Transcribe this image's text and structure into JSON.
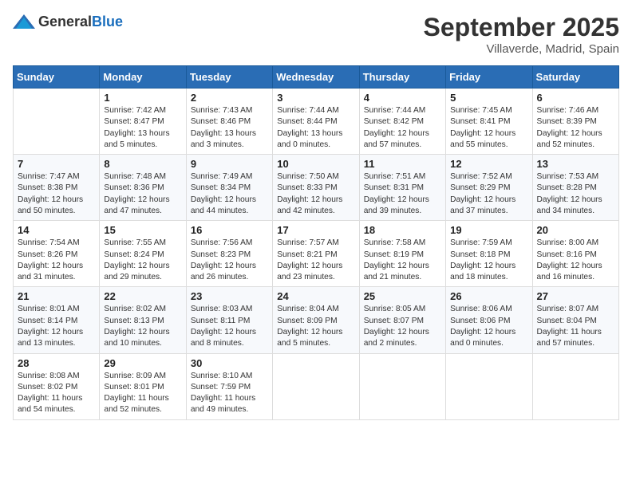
{
  "logo": {
    "general": "General",
    "blue": "Blue"
  },
  "header": {
    "month": "September 2025",
    "location": "Villaverde, Madrid, Spain"
  },
  "weekdays": [
    "Sunday",
    "Monday",
    "Tuesday",
    "Wednesday",
    "Thursday",
    "Friday",
    "Saturday"
  ],
  "weeks": [
    [
      {
        "day": "",
        "info": ""
      },
      {
        "day": "1",
        "info": "Sunrise: 7:42 AM\nSunset: 8:47 PM\nDaylight: 13 hours\nand 5 minutes."
      },
      {
        "day": "2",
        "info": "Sunrise: 7:43 AM\nSunset: 8:46 PM\nDaylight: 13 hours\nand 3 minutes."
      },
      {
        "day": "3",
        "info": "Sunrise: 7:44 AM\nSunset: 8:44 PM\nDaylight: 13 hours\nand 0 minutes."
      },
      {
        "day": "4",
        "info": "Sunrise: 7:44 AM\nSunset: 8:42 PM\nDaylight: 12 hours\nand 57 minutes."
      },
      {
        "day": "5",
        "info": "Sunrise: 7:45 AM\nSunset: 8:41 PM\nDaylight: 12 hours\nand 55 minutes."
      },
      {
        "day": "6",
        "info": "Sunrise: 7:46 AM\nSunset: 8:39 PM\nDaylight: 12 hours\nand 52 minutes."
      }
    ],
    [
      {
        "day": "7",
        "info": "Sunrise: 7:47 AM\nSunset: 8:38 PM\nDaylight: 12 hours\nand 50 minutes."
      },
      {
        "day": "8",
        "info": "Sunrise: 7:48 AM\nSunset: 8:36 PM\nDaylight: 12 hours\nand 47 minutes."
      },
      {
        "day": "9",
        "info": "Sunrise: 7:49 AM\nSunset: 8:34 PM\nDaylight: 12 hours\nand 44 minutes."
      },
      {
        "day": "10",
        "info": "Sunrise: 7:50 AM\nSunset: 8:33 PM\nDaylight: 12 hours\nand 42 minutes."
      },
      {
        "day": "11",
        "info": "Sunrise: 7:51 AM\nSunset: 8:31 PM\nDaylight: 12 hours\nand 39 minutes."
      },
      {
        "day": "12",
        "info": "Sunrise: 7:52 AM\nSunset: 8:29 PM\nDaylight: 12 hours\nand 37 minutes."
      },
      {
        "day": "13",
        "info": "Sunrise: 7:53 AM\nSunset: 8:28 PM\nDaylight: 12 hours\nand 34 minutes."
      }
    ],
    [
      {
        "day": "14",
        "info": "Sunrise: 7:54 AM\nSunset: 8:26 PM\nDaylight: 12 hours\nand 31 minutes."
      },
      {
        "day": "15",
        "info": "Sunrise: 7:55 AM\nSunset: 8:24 PM\nDaylight: 12 hours\nand 29 minutes."
      },
      {
        "day": "16",
        "info": "Sunrise: 7:56 AM\nSunset: 8:23 PM\nDaylight: 12 hours\nand 26 minutes."
      },
      {
        "day": "17",
        "info": "Sunrise: 7:57 AM\nSunset: 8:21 PM\nDaylight: 12 hours\nand 23 minutes."
      },
      {
        "day": "18",
        "info": "Sunrise: 7:58 AM\nSunset: 8:19 PM\nDaylight: 12 hours\nand 21 minutes."
      },
      {
        "day": "19",
        "info": "Sunrise: 7:59 AM\nSunset: 8:18 PM\nDaylight: 12 hours\nand 18 minutes."
      },
      {
        "day": "20",
        "info": "Sunrise: 8:00 AM\nSunset: 8:16 PM\nDaylight: 12 hours\nand 16 minutes."
      }
    ],
    [
      {
        "day": "21",
        "info": "Sunrise: 8:01 AM\nSunset: 8:14 PM\nDaylight: 12 hours\nand 13 minutes."
      },
      {
        "day": "22",
        "info": "Sunrise: 8:02 AM\nSunset: 8:13 PM\nDaylight: 12 hours\nand 10 minutes."
      },
      {
        "day": "23",
        "info": "Sunrise: 8:03 AM\nSunset: 8:11 PM\nDaylight: 12 hours\nand 8 minutes."
      },
      {
        "day": "24",
        "info": "Sunrise: 8:04 AM\nSunset: 8:09 PM\nDaylight: 12 hours\nand 5 minutes."
      },
      {
        "day": "25",
        "info": "Sunrise: 8:05 AM\nSunset: 8:07 PM\nDaylight: 12 hours\nand 2 minutes."
      },
      {
        "day": "26",
        "info": "Sunrise: 8:06 AM\nSunset: 8:06 PM\nDaylight: 12 hours\nand 0 minutes."
      },
      {
        "day": "27",
        "info": "Sunrise: 8:07 AM\nSunset: 8:04 PM\nDaylight: 11 hours\nand 57 minutes."
      }
    ],
    [
      {
        "day": "28",
        "info": "Sunrise: 8:08 AM\nSunset: 8:02 PM\nDaylight: 11 hours\nand 54 minutes."
      },
      {
        "day": "29",
        "info": "Sunrise: 8:09 AM\nSunset: 8:01 PM\nDaylight: 11 hours\nand 52 minutes."
      },
      {
        "day": "30",
        "info": "Sunrise: 8:10 AM\nSunset: 7:59 PM\nDaylight: 11 hours\nand 49 minutes."
      },
      {
        "day": "",
        "info": ""
      },
      {
        "day": "",
        "info": ""
      },
      {
        "day": "",
        "info": ""
      },
      {
        "day": "",
        "info": ""
      }
    ]
  ]
}
